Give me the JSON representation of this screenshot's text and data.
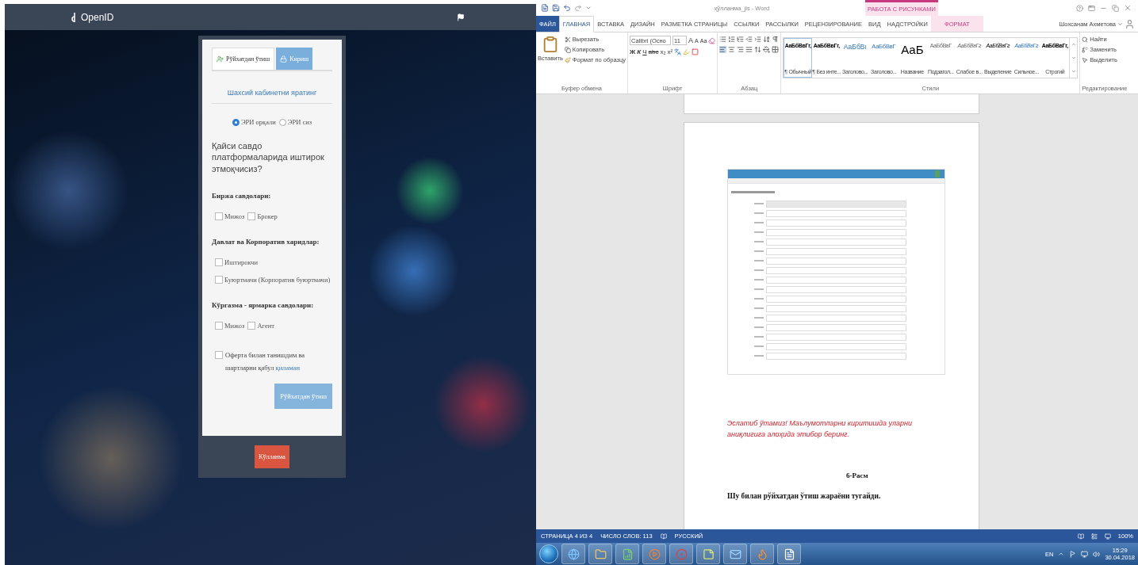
{
  "browser": {
    "brand": "OpenID"
  },
  "form": {
    "tabs": [
      {
        "label": "Рўйхатдан ўтиш",
        "selected": true,
        "kind": "register"
      },
      {
        "label": "Кириш",
        "selected": false,
        "kind": "login"
      }
    ],
    "title": "Шахсий кабинетни яратинг",
    "radios": [
      {
        "label": "ЭРИ орқали",
        "selected": true
      },
      {
        "label": "ЭРИ сиз",
        "selected": false
      }
    ],
    "question": "Қайси савдо платформаларида иштирок этмоқчисиз?",
    "sections": [
      {
        "heading": "Биржа савдолари:",
        "inline": true,
        "options": [
          {
            "label": "Мижоз",
            "checked": false
          },
          {
            "label": "Брокер",
            "checked": false
          }
        ]
      },
      {
        "heading": "Давлат ва Корпоратив харидлар:",
        "inline": false,
        "options": [
          {
            "label": "Иштирокчи",
            "checked": false
          },
          {
            "label": "Буюртмачи (Корпоратив буюртмачи)",
            "checked": false
          }
        ]
      },
      {
        "heading": "Кўргазма - ярмарка савдолари:",
        "inline": true,
        "options": [
          {
            "label": "Мижоз",
            "checked": false
          },
          {
            "label": "Агент",
            "checked": false
          }
        ]
      }
    ],
    "agreement": {
      "text": "Оферта билан танишдим ва шартларни қабул",
      "link": "қиламан",
      "checked": false
    },
    "submit": "Рўйхатдан ўтиш",
    "footer_button": "Кўлланма"
  },
  "word": {
    "title": "қўлланма_јis - Word",
    "context_group": "РАБОТА С РИСУНКАМИ",
    "tabs": [
      {
        "label": "ФАЙЛ",
        "selected": false,
        "kind": "file"
      },
      {
        "label": "ГЛАВНАЯ",
        "selected": true,
        "kind": "tab"
      },
      {
        "label": "ВСТАВКА",
        "selected": false,
        "kind": "tab"
      },
      {
        "label": "ДИЗАЙН",
        "selected": false,
        "kind": "tab"
      },
      {
        "label": "РАЗМЕТКА СТРАНИЦЫ",
        "selected": false,
        "kind": "tab"
      },
      {
        "label": "ССЫЛКИ",
        "selected": false,
        "kind": "tab"
      },
      {
        "label": "РАССЫЛКИ",
        "selected": false,
        "kind": "tab"
      },
      {
        "label": "РЕЦЕНЗИРОВАНИЕ",
        "selected": false,
        "kind": "tab"
      },
      {
        "label": "ВИД",
        "selected": false,
        "kind": "tab"
      },
      {
        "label": "НАДСТРОЙКИ",
        "selected": false,
        "kind": "tab"
      },
      {
        "label": "ФОРМАТ",
        "selected": false,
        "kind": "context"
      }
    ],
    "user": "Шохсанам Ахметова",
    "clipboard": {
      "paste": "Вставить",
      "items": [
        "Вырезать",
        "Копировать",
        "Формат по образцу"
      ],
      "label": "Буфер обмена"
    },
    "font": {
      "name": "Calibri (Осно",
      "size": "11",
      "size_buttons": [
        "A",
        "A",
        "Aa"
      ],
      "format_buttons": [
        "Ж",
        "К",
        "Ч",
        "abc",
        "x₂",
        "x²"
      ],
      "label": "Шрифт"
    },
    "paragraph": {
      "label": "Абзац"
    },
    "styles": {
      "label": "Стили",
      "items": [
        {
          "preview": "АаБбВвГг,",
          "name": "¶ Обычный",
          "selected": true,
          "kind": "normal"
        },
        {
          "preview": "АаБбВвГг,",
          "name": "¶ Без инте...",
          "selected": false,
          "kind": "normal"
        },
        {
          "preview": "АаБбВı",
          "name": "Заголово...",
          "selected": false,
          "kind": "heading1"
        },
        {
          "preview": "АаБбВвГ",
          "name": "Заголово...",
          "selected": false,
          "kind": "heading2"
        },
        {
          "preview": "АаБ",
          "name": "Название",
          "selected": false,
          "kind": "title"
        },
        {
          "preview": "АаБбВвГ",
          "name": "Подзагол...",
          "selected": false,
          "kind": "subtitle"
        },
        {
          "preview": "АаБбВвГг",
          "name": "Слабое в...",
          "selected": false,
          "kind": "subtle"
        },
        {
          "preview": "АаБбВвГг",
          "name": "Выделение",
          "selected": false,
          "kind": "emphasis"
        },
        {
          "preview": "АаБбВвГг",
          "name": "Сильное...",
          "selected": false,
          "kind": "intense"
        },
        {
          "preview": "АаБбВвГг,",
          "name": "Строгий",
          "selected": false,
          "kind": "strong"
        }
      ]
    },
    "editing": {
      "label": "Редактирование",
      "items": [
        "Найти",
        "Заменить",
        "Выделить"
      ]
    },
    "document": {
      "note": "Эслатиб ўтамиз! Маълумотларни киритишда уларни аниқлигига алоҳида этибор беринг.",
      "caption": "6-Расм",
      "paragraph": "Шу билан рўйхатдан ўтиш жараёни тугайди."
    },
    "status": {
      "page": "СТРАНИЦА 4 ИЗ 4",
      "words": "ЧИСЛО СЛОВ: 113",
      "language": "РУССКИЙ",
      "zoom": "100%"
    }
  },
  "taskbar": {
    "language": "EN",
    "time": "15:29",
    "date": "30.04.2018"
  }
}
